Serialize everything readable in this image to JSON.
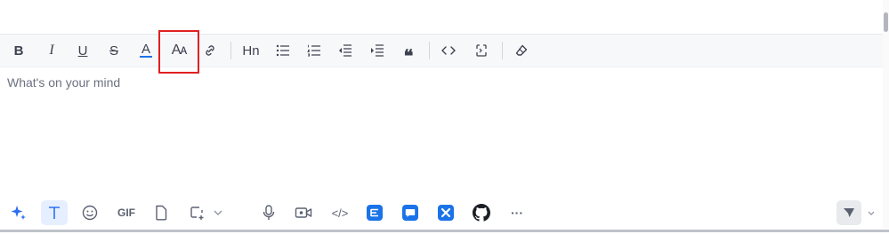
{
  "editor": {
    "placeholder": "What's on your mind"
  },
  "format_toolbar": {
    "bold": "B",
    "italic": "I",
    "underline": "U",
    "strikethrough": "S",
    "font_color": "A",
    "font_size": "Aᴀ",
    "heading": "Hn",
    "quote": "❝"
  },
  "bottom_toolbar": {
    "gif": "GIF",
    "code": "</>",
    "more": "···"
  },
  "colors": {
    "accent_blue": "#1a73e8",
    "highlight_red": "#e02020",
    "text_toolbar_active": "#e6efff"
  }
}
